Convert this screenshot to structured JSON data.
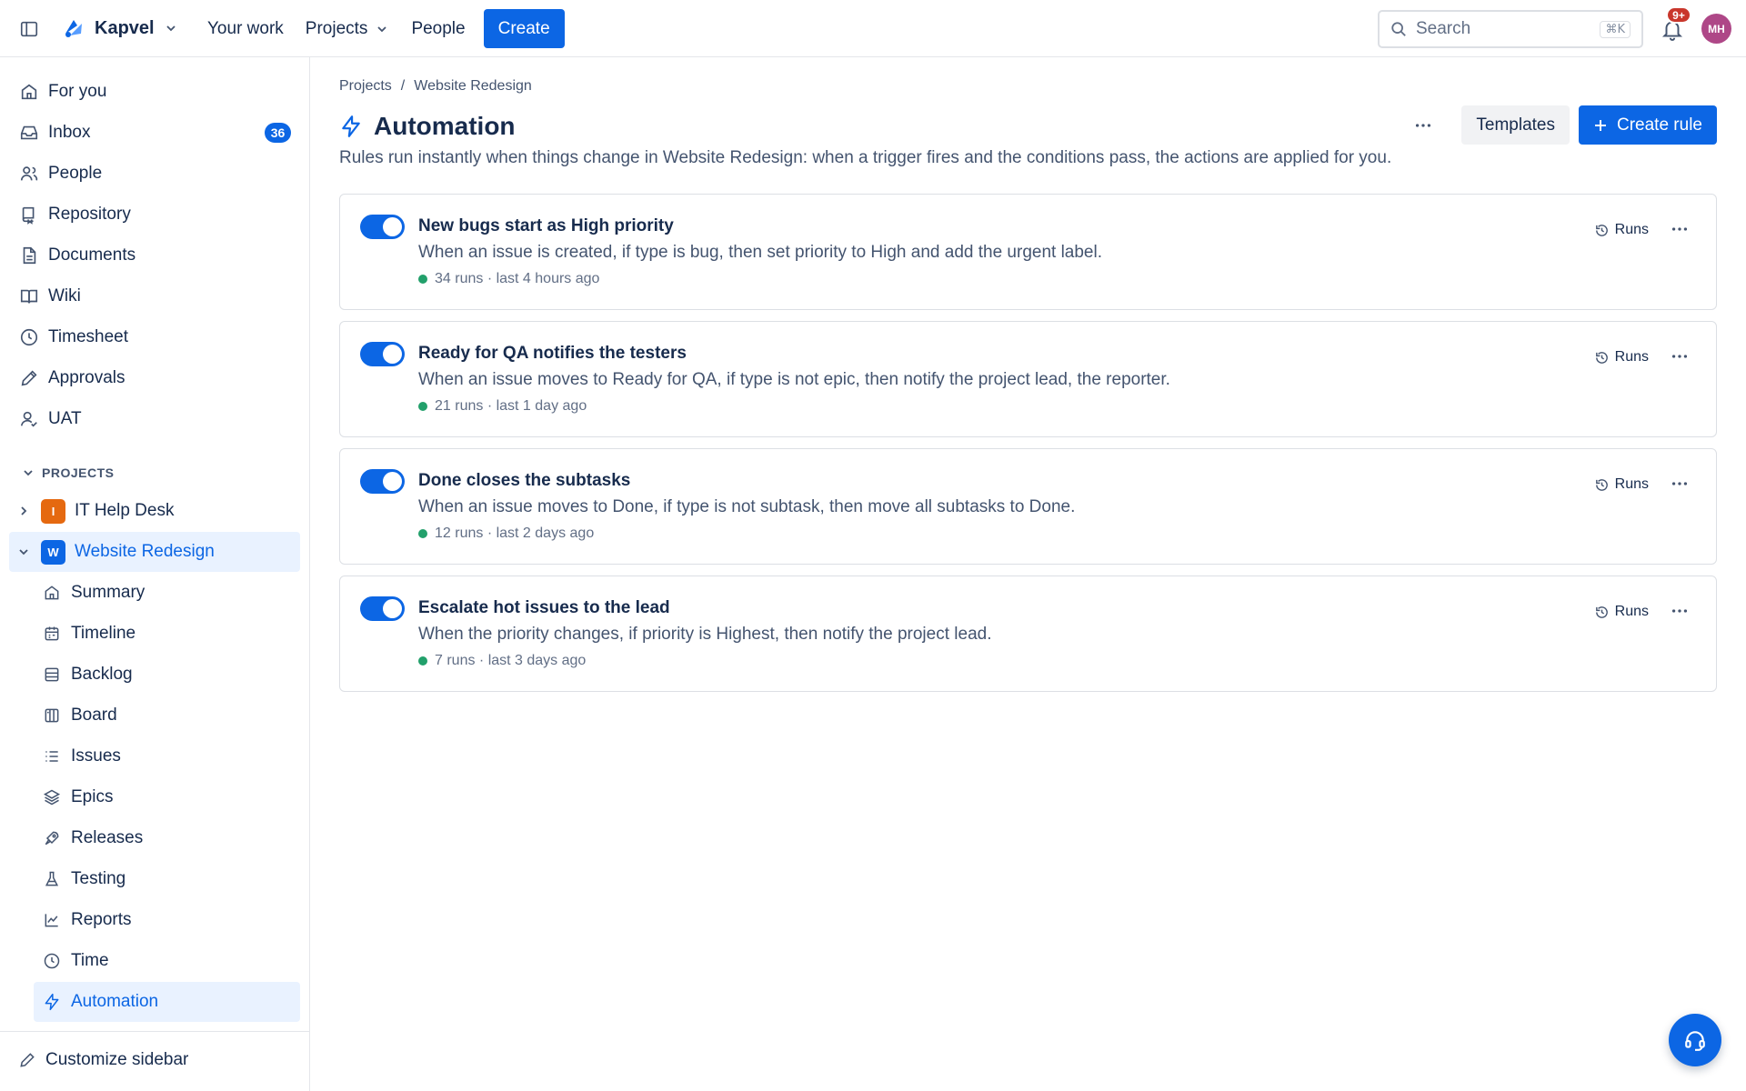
{
  "topbar": {
    "brand_name": "Kapvel",
    "nav": [
      {
        "label": "Your work"
      },
      {
        "label": "Projects"
      },
      {
        "label": "People"
      }
    ],
    "create_label": "Create",
    "search_placeholder": "Search",
    "search_shortcut": "⌘K",
    "notifications_badge": "9+",
    "avatar_initials": "MH"
  },
  "sidebar": {
    "items": [
      {
        "label": "For you",
        "icon": "home-icon"
      },
      {
        "label": "Inbox",
        "icon": "inbox-icon",
        "badge": "36"
      },
      {
        "label": "People",
        "icon": "people-icon"
      },
      {
        "label": "Repository",
        "icon": "repository-icon"
      },
      {
        "label": "Documents",
        "icon": "document-icon"
      },
      {
        "label": "Wiki",
        "icon": "book-icon"
      },
      {
        "label": "Timesheet",
        "icon": "clock-icon"
      },
      {
        "label": "Approvals",
        "icon": "pen-icon"
      },
      {
        "label": "UAT",
        "icon": "user-check-icon"
      }
    ],
    "projects_heading": "PROJECTS",
    "projects": [
      {
        "label": "IT Help Desk",
        "initial": "I",
        "color": "#e56910"
      },
      {
        "label": "Website Redesign",
        "initial": "W",
        "color": "#0c66e4"
      }
    ],
    "project_children": [
      {
        "label": "Summary",
        "icon": "home-icon"
      },
      {
        "label": "Timeline",
        "icon": "calendar-icon"
      },
      {
        "label": "Backlog",
        "icon": "backlog-icon"
      },
      {
        "label": "Board",
        "icon": "board-icon"
      },
      {
        "label": "Issues",
        "icon": "list-icon"
      },
      {
        "label": "Epics",
        "icon": "layers-icon"
      },
      {
        "label": "Releases",
        "icon": "rocket-icon"
      },
      {
        "label": "Testing",
        "icon": "flask-icon"
      },
      {
        "label": "Reports",
        "icon": "chart-icon"
      },
      {
        "label": "Time",
        "icon": "clock-icon"
      },
      {
        "label": "Automation",
        "icon": "bolt-icon"
      }
    ],
    "footer_label": "Customize sidebar"
  },
  "main": {
    "breadcrumb": [
      "Projects",
      "/",
      "Website Redesign"
    ],
    "title": "Automation",
    "templates_label": "Templates",
    "create_rule_label": "Create rule",
    "description": "Rules run instantly when things change in Website Redesign: when a trigger fires and the conditions pass, the actions are applied for you.",
    "runs_label": "Runs",
    "rules": [
      {
        "title": "New bugs start as High priority",
        "description": "When an issue is created, if type is bug, then set priority to High and add the urgent label.",
        "meta": "34 runs · last 4 hours ago",
        "enabled": true
      },
      {
        "title": "Ready for QA notifies the testers",
        "description": "When an issue moves to Ready for QA, if type is not epic, then notify the project lead, the reporter.",
        "meta": "21 runs · last 1 day ago",
        "enabled": true
      },
      {
        "title": "Done closes the subtasks",
        "description": "When an issue moves to Done, if type is not subtask, then move all subtasks to Done.",
        "meta": "12 runs · last 2 days ago",
        "enabled": true
      },
      {
        "title": "Escalate hot issues to the lead",
        "description": "When the priority changes, if priority is Highest, then notify the project lead.",
        "meta": "7 runs · last 3 days ago",
        "enabled": true
      }
    ]
  },
  "colors": {
    "accent": "#0c66e4",
    "status_ok": "#22a06b",
    "notification": "#c9372c",
    "avatar": "#ae4787"
  }
}
